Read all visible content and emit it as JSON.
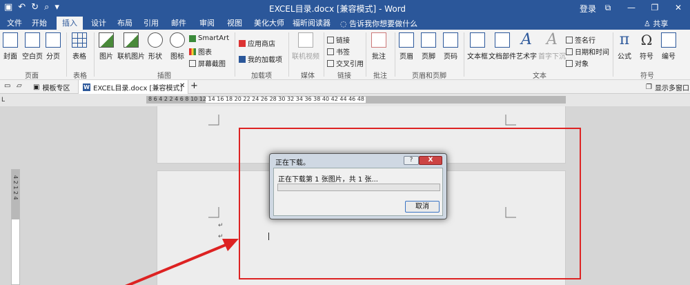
{
  "titlebar": {
    "title": "EXCEL目录.docx [兼容模式] - Word",
    "login": "登录",
    "restore_icon": "⧉",
    "minimize_icon": "—",
    "maximize_icon": "❐",
    "close_icon": "✕"
  },
  "tabs": [
    "文件",
    "开始",
    "插入",
    "设计",
    "布局",
    "引用",
    "邮件",
    "审阅",
    "视图",
    "美化大师",
    "福昕阅读器"
  ],
  "active_tab": "插入",
  "tellme": "告诉我你想要做什么",
  "share": "共享",
  "ribbon": {
    "buttons": {
      "cover": "封面",
      "blank_page": "空白页",
      "page_break": "分页",
      "table": "表格",
      "picture": "图片",
      "online_picture": "联机图片",
      "shape": "形状",
      "icon": "图标",
      "smartart": "SmartArt",
      "chart": "图表",
      "screenshot": "屏幕截图",
      "app_store": "应用商店",
      "my_addins": "我的加载项",
      "online_video": "联机视频",
      "link": "链接",
      "bookmark": "书签",
      "cross_ref": "交叉引用",
      "comment": "批注",
      "header": "页眉",
      "footer": "页脚",
      "page_number": "页码",
      "textbox": "文本框",
      "doc_parts": "文档部件",
      "wordart": "艺术字",
      "dropcap": "首字下沉",
      "signature_line": "签名行",
      "date_time": "日期和时间",
      "object": "对象",
      "equation": "公式",
      "symbol": "符号",
      "numbering": "编号"
    },
    "groups": {
      "pages": "页面",
      "tables": "表格",
      "illustrations": "插图",
      "addins": "加载项",
      "media": "媒体",
      "links": "链接",
      "comments": "批注",
      "header_footer": "页眉和页脚",
      "text": "文本",
      "symbols": "符号"
    }
  },
  "docbar": {
    "template_zone": "模板专区",
    "doc_tab": "EXCEL目录.docx [兼容模式]",
    "close": "✕",
    "new_tab": "+",
    "show_windows": "显示多窗口"
  },
  "ruler": {
    "corner": "L",
    "h_ticks": "8  6  4  2     2  4  6  8  10  12  14  16  18  20  22  24  26  28  30  32  34  36  38  40  42  44  46  48",
    "v_ticks": "4  2  1  2  4"
  },
  "dialog": {
    "title": "正在下载。",
    "help": "?",
    "close": "X",
    "message": "正在下载第 1 张图片，共 1 张...",
    "progress": 0,
    "cancel": "取消"
  },
  "colors": {
    "brand": "#2b579a",
    "annotation_red": "#d22222"
  }
}
